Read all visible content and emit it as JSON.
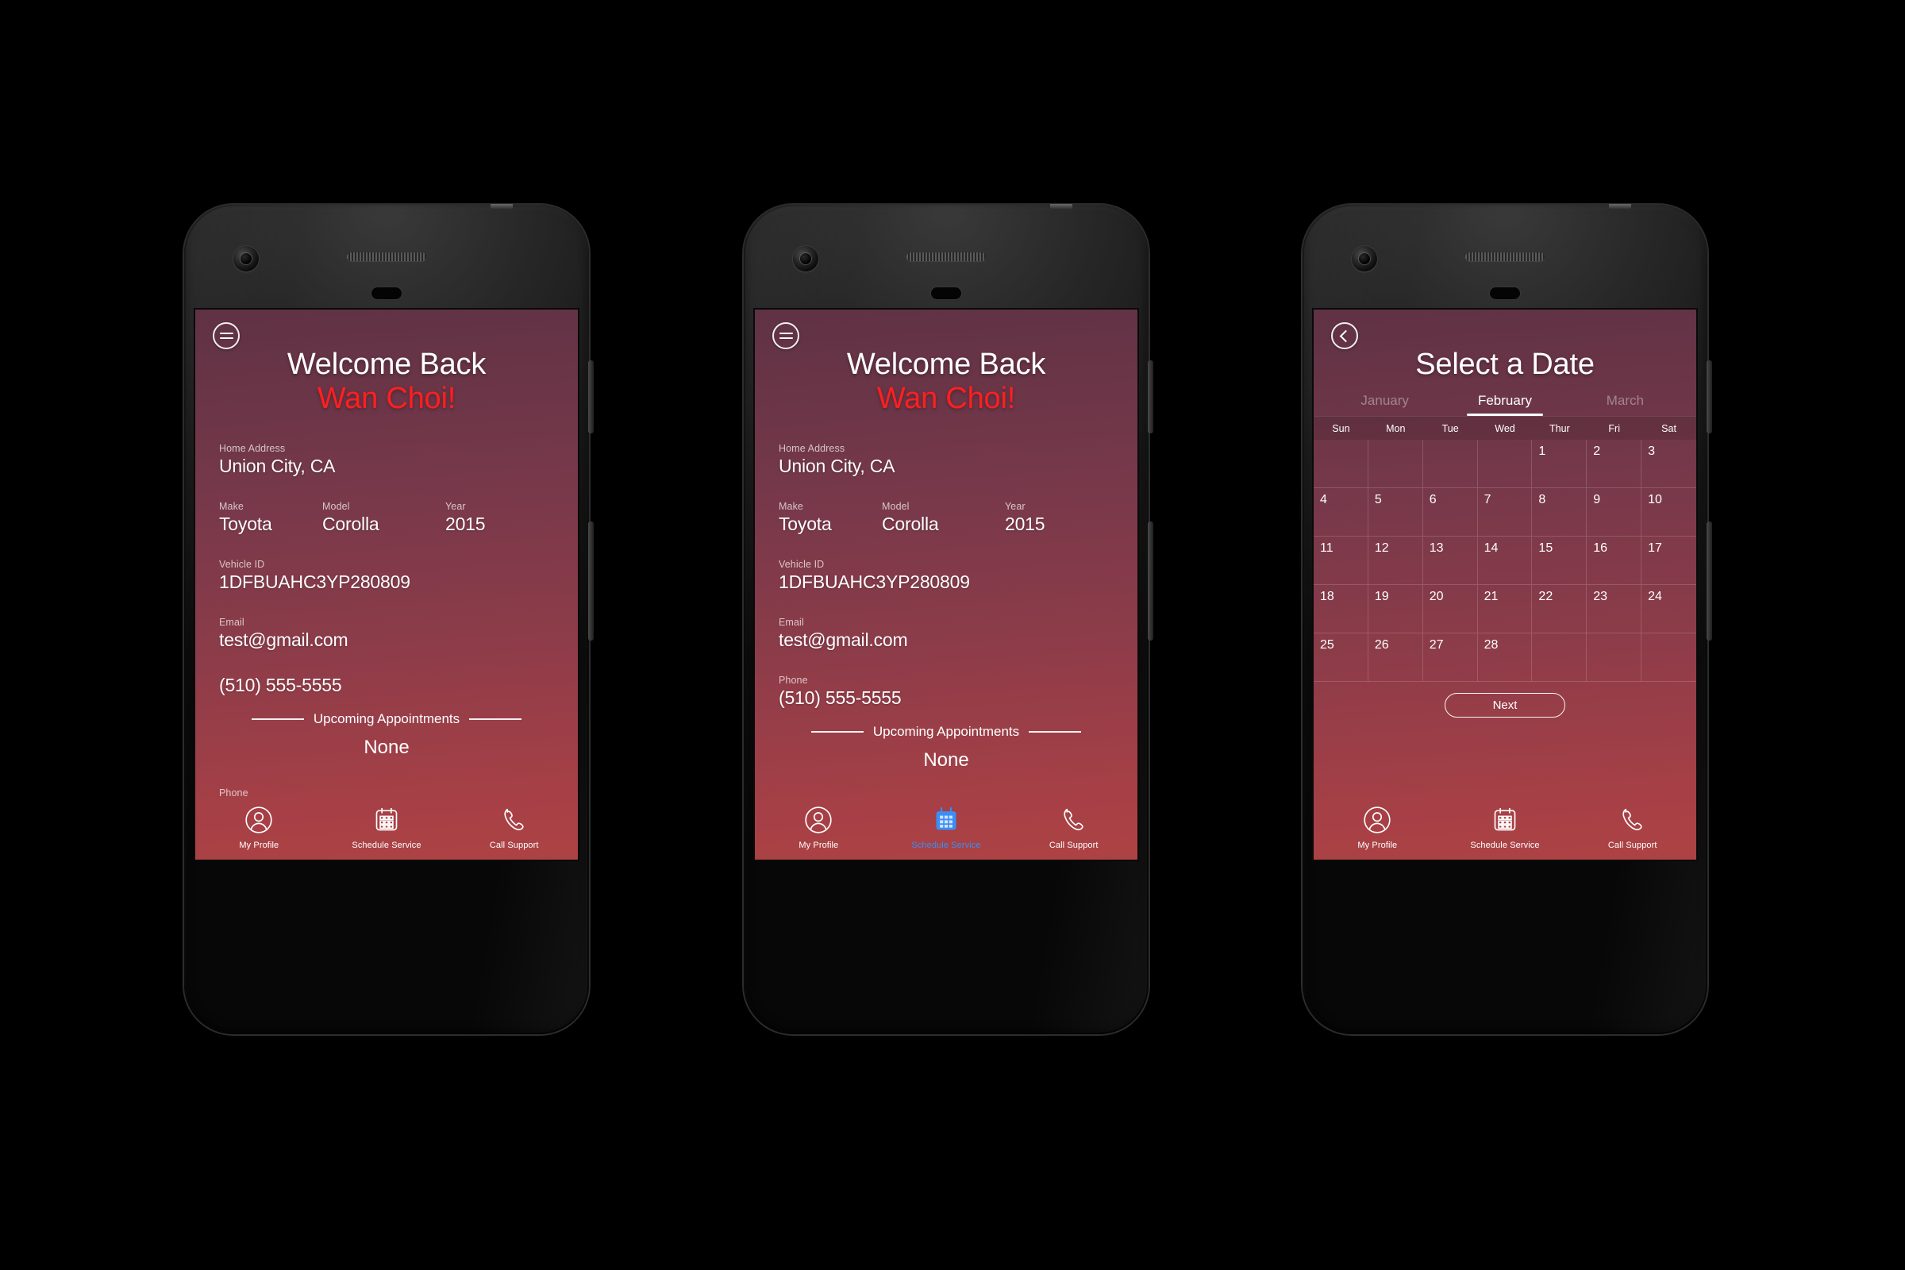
{
  "theme": {
    "gradient_top": "#5f3244",
    "gradient_bottom": "#ad4244",
    "accent_red": "#ff1f1f",
    "accent_blue": "#3b8ef5",
    "text_white": "#ffffff"
  },
  "profile": {
    "menu_icon": "hamburger-icon",
    "welcome_line1": "Welcome Back",
    "welcome_line2": "Wan Choi!",
    "home_address_label": "Home Address",
    "home_address_value": "Union City, CA",
    "make_label": "Make",
    "make_value": "Toyota",
    "model_label": "Model",
    "model_value": "Corolla",
    "year_label": "Year",
    "year_value": "2015",
    "vehicle_id_label": "Vehicle ID",
    "vehicle_id_value": "1DFBUAHC3YP280809",
    "email_label": "Email",
    "email_value": "test@gmail.com",
    "phone_label": "Phone",
    "phone_value": "(510) 555-5555",
    "appointments_heading": "Upcoming Appointments",
    "appointments_value": "None"
  },
  "tabbar": {
    "items": [
      {
        "icon": "person-circle-icon",
        "label": "My Profile",
        "active": false
      },
      {
        "icon": "calendar-icon",
        "label": "Schedule Service",
        "active": false
      },
      {
        "icon": "phone-handset-icon",
        "label": "Call Support",
        "active": false
      }
    ],
    "items_screen2": [
      {
        "icon": "person-circle-icon",
        "label": "My Profile",
        "active": false
      },
      {
        "icon": "calendar-filled-icon",
        "label": "Schedule Service",
        "active": true
      },
      {
        "icon": "phone-handset-icon",
        "label": "Call Support",
        "active": false
      }
    ]
  },
  "calendar": {
    "back_icon": "chevron-left-circle-icon",
    "title": "Select a Date",
    "months": [
      {
        "label": "January",
        "selected": false
      },
      {
        "label": "February",
        "selected": true
      },
      {
        "label": "March",
        "selected": false
      }
    ],
    "weekdays": [
      "Sun",
      "Mon",
      "Tue",
      "Wed",
      "Thur",
      "Fri",
      "Sat"
    ],
    "leading_blanks": 4,
    "days": [
      1,
      2,
      3,
      4,
      5,
      6,
      7,
      8,
      9,
      10,
      11,
      12,
      13,
      14,
      15,
      16,
      17,
      18,
      19,
      20,
      21,
      22,
      23,
      24,
      25,
      26,
      27,
      28
    ],
    "trailing_blanks": 3,
    "next_label": "Next"
  }
}
